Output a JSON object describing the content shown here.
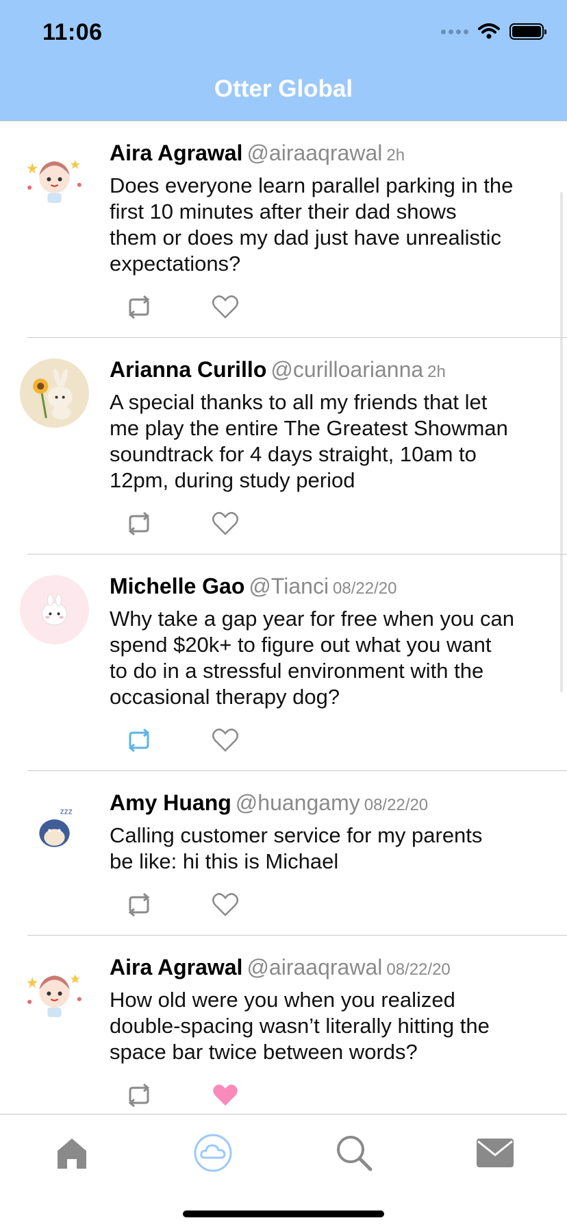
{
  "status": {
    "time": "11:06"
  },
  "nav": {
    "title": "Otter Global"
  },
  "colors": {
    "header": "#9bc9fb",
    "retweet_active": "#5ab3e6",
    "like_active": "#fa8ab9",
    "tab_active": "#9bc9fb"
  },
  "tweets": [
    {
      "name": "Aira Agrawal",
      "handle": "@airaaqrawal",
      "time": "2h",
      "lines": [
        "Does everyone learn parallel parking in the",
        "first 10 minutes after their dad shows",
        "them or does my dad just have unrealistic",
        "expectations?"
      ],
      "avatar": "girl-avatar",
      "retweeted": false,
      "liked": false
    },
    {
      "name": "Arianna Curillo",
      "handle": "@curilloarianna",
      "time": "2h",
      "lines": [
        "A special thanks to all my friends that let",
        "me play the entire The Greatest Showman",
        "soundtrack for 4 days straight, 10am to",
        "12pm, during study period"
      ],
      "avatar": "bunny-sunflower-avatar",
      "retweeted": false,
      "liked": false
    },
    {
      "name": "Michelle Gao",
      "handle": "@Tianci",
      "time": "08/22/20",
      "lines": [
        "Why take a gap year for free when you can",
        "spend $20k+ to figure out what you want",
        "to do in a stressful environment with the",
        "occasional therapy dog?"
      ],
      "avatar": "mochi-bunny-avatar",
      "retweeted": true,
      "liked": false
    },
    {
      "name": "Amy Huang",
      "handle": "@huangamy",
      "time": "08/22/20",
      "lines": [
        "Calling customer service for my parents",
        "be like: hi this is Michael"
      ],
      "avatar": "sleepy-creature-avatar",
      "retweeted": false,
      "liked": false
    },
    {
      "name": "Aira Agrawal",
      "handle": "@airaaqrawal",
      "time": "08/22/20",
      "lines": [
        "How old were you when you realized",
        "double-spacing wasn’t literally hitting the",
        "space bar twice between words?"
      ],
      "avatar": "girl-avatar",
      "retweeted": false,
      "liked": true
    }
  ],
  "tabs": [
    {
      "name": "home",
      "icon": "home-icon",
      "active": false
    },
    {
      "name": "cloud",
      "icon": "cloud-icon",
      "active": true
    },
    {
      "name": "search",
      "icon": "search-icon",
      "active": false
    },
    {
      "name": "messages",
      "icon": "mail-icon",
      "active": false
    }
  ]
}
